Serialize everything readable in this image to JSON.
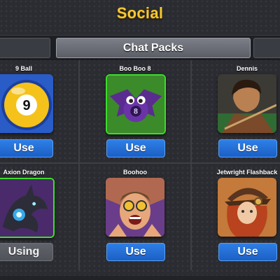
{
  "header": {
    "title": "Social"
  },
  "tabs": {
    "active_label": "Chat Packs"
  },
  "cards": [
    {
      "name": "9 Ball",
      "action": "Use"
    },
    {
      "name": "Boo Boo 8",
      "action": "Use"
    },
    {
      "name": "Dennis",
      "action": "Use"
    },
    {
      "name": "Axion Dragon",
      "action": "Using"
    },
    {
      "name": "Boohoo",
      "action": "Use"
    },
    {
      "name": "Jetwright Flashback",
      "action": "Use"
    }
  ],
  "theme": {
    "accent": "#f7c830",
    "button_blue": "#1f6ad3",
    "selected_border": "#3ddc2e"
  }
}
